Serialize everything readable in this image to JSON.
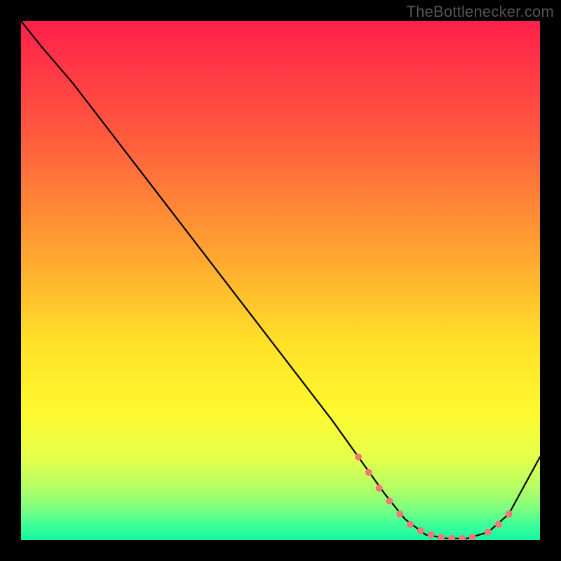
{
  "watermark": "TheBottlenecker.com",
  "chart_data": {
    "type": "line",
    "title": "",
    "xlabel": "",
    "ylabel": "",
    "xlim": [
      0,
      100
    ],
    "ylim": [
      0,
      100
    ],
    "background_gradient": {
      "stops": [
        {
          "offset": 0,
          "color": "#ff1f4b"
        },
        {
          "offset": 22,
          "color": "#ff5a3e"
        },
        {
          "offset": 45,
          "color": "#ffa531"
        },
        {
          "offset": 62,
          "color": "#ffe128"
        },
        {
          "offset": 75,
          "color": "#fff92f"
        },
        {
          "offset": 84,
          "color": "#e6ff4a"
        },
        {
          "offset": 90,
          "color": "#b3ff66"
        },
        {
          "offset": 94,
          "color": "#7dff80"
        },
        {
          "offset": 97,
          "color": "#3fff98"
        },
        {
          "offset": 100,
          "color": "#17f7a1"
        }
      ]
    },
    "series": [
      {
        "name": "bottleneck-curve",
        "stroke": "#000000",
        "stroke_width": 2.2,
        "x": [
          0,
          4,
          10,
          20,
          30,
          40,
          50,
          60,
          65,
          70,
          74,
          78,
          82,
          86,
          90,
          94,
          100
        ],
        "y": [
          100,
          95,
          88,
          75,
          62,
          49,
          36,
          23,
          16,
          9,
          4,
          1,
          0.3,
          0.3,
          1.5,
          5,
          16
        ]
      }
    ],
    "markers": {
      "name": "highlight-points",
      "color": "#f07878",
      "radius": 5,
      "x": [
        65,
        67,
        69,
        71,
        73,
        75,
        77,
        79,
        81,
        83,
        85,
        87,
        90,
        92,
        94
      ],
      "y": [
        16,
        13,
        10,
        7.5,
        5,
        3,
        1.8,
        1,
        0.5,
        0.3,
        0.3,
        0.5,
        1.5,
        3,
        5
      ]
    }
  }
}
